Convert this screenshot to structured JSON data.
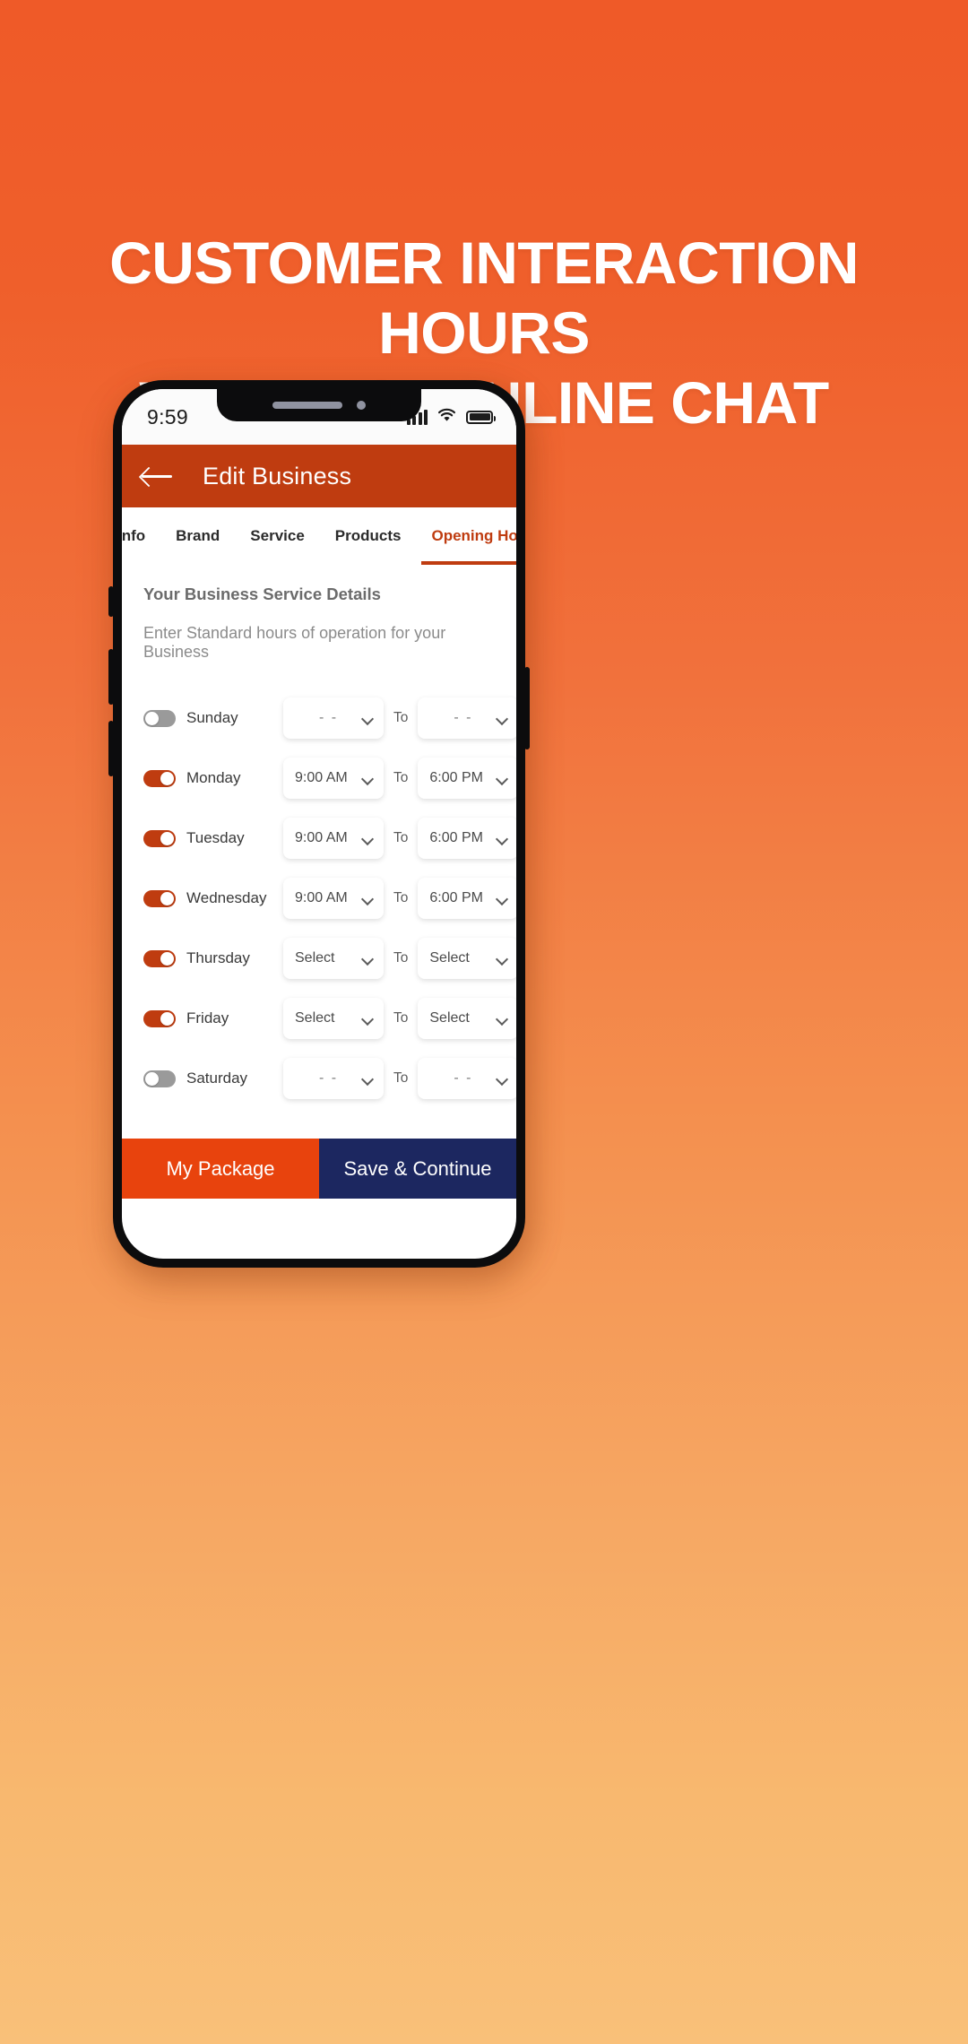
{
  "promo": {
    "background_top_color": "#ef5a28",
    "background_bottom_color": "#f9c079",
    "headline_line1": "CUSTOMER INTERACTION HOURS",
    "headline_line2": "WITH 24/7 ONLINE CHAT"
  },
  "status_bar": {
    "clock": "9:59",
    "signal_icon": "signal-bars-icon",
    "wifi_icon": "wifi-icon",
    "battery_icon": "battery-full-icon"
  },
  "header": {
    "back_icon": "arrow-left-icon",
    "title": "Edit Business",
    "background_color": "#bf3c10"
  },
  "tabs": {
    "accent_color": "#bf3c10",
    "items": [
      {
        "label": "Info",
        "active": false
      },
      {
        "label": "Brand",
        "active": false
      },
      {
        "label": "Service",
        "active": false
      },
      {
        "label": "Products",
        "active": false
      },
      {
        "label": "Opening Hours",
        "active": true
      }
    ]
  },
  "main": {
    "section_title": "Your Business Service Details",
    "section_subtitle": "Enter Standard hours of operation for your Business",
    "to_label": "To",
    "chevron_icon": "chevron-down-icon",
    "days": [
      {
        "name": "Sunday",
        "enabled": false,
        "open": "- -",
        "close": "- -",
        "open_is_placeholder": true,
        "close_is_placeholder": true
      },
      {
        "name": "Monday",
        "enabled": true,
        "open": "9:00 AM",
        "close": "6:00 PM",
        "open_is_placeholder": false,
        "close_is_placeholder": false
      },
      {
        "name": "Tuesday",
        "enabled": true,
        "open": "9:00 AM",
        "close": "6:00 PM",
        "open_is_placeholder": false,
        "close_is_placeholder": false
      },
      {
        "name": "Wednesday",
        "enabled": true,
        "open": "9:00 AM",
        "close": "6:00 PM",
        "open_is_placeholder": false,
        "close_is_placeholder": false
      },
      {
        "name": "Thursday",
        "enabled": true,
        "open": "Select",
        "close": "Select",
        "open_is_placeholder": false,
        "close_is_placeholder": false
      },
      {
        "name": "Friday",
        "enabled": true,
        "open": "Select",
        "close": "Select",
        "open_is_placeholder": false,
        "close_is_placeholder": false
      },
      {
        "name": "Saturday",
        "enabled": false,
        "open": "- -",
        "close": "- -",
        "open_is_placeholder": true,
        "close_is_placeholder": true
      }
    ]
  },
  "bottom_bar": {
    "my_package_label": "My Package",
    "my_package_color": "#e8430d",
    "save_label": "Save & Continue",
    "save_color": "#1c2760"
  }
}
